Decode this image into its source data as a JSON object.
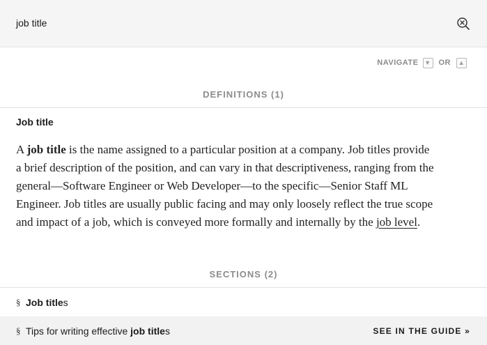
{
  "search": {
    "value": "job title",
    "clear_icon": "search-clear-icon"
  },
  "navigate": {
    "label": "NAVIGATE",
    "down_key": "▼",
    "or": "OR",
    "up_key": "▲"
  },
  "definitions": {
    "heading": "DEFINITIONS (1)",
    "items": [
      {
        "term": "Job title",
        "body_prefix": "A ",
        "body_bold": "job title",
        "body_main": " is the name assigned to a particular position at a company. Job titles provide a brief description of the position, and can vary in that descriptiveness, ranging from the general—Software Engineer or Web Developer—to the specific—Senior Staff ML Engineer. Job titles are usually public facing and may only loosely reflect the true scope and impact of a job, which is conveyed more formally and internally by the ",
        "body_link": "job level",
        "body_suffix": "."
      }
    ]
  },
  "sections": {
    "heading": "SECTIONS (2)",
    "items": [
      {
        "mark": "§",
        "prefix": "",
        "bold": "Job title",
        "suffix": "s"
      },
      {
        "mark": "§",
        "prefix": "Tips for writing effective ",
        "bold": "job title",
        "suffix": "s",
        "action": "SEE IN THE GUIDE »"
      }
    ]
  }
}
